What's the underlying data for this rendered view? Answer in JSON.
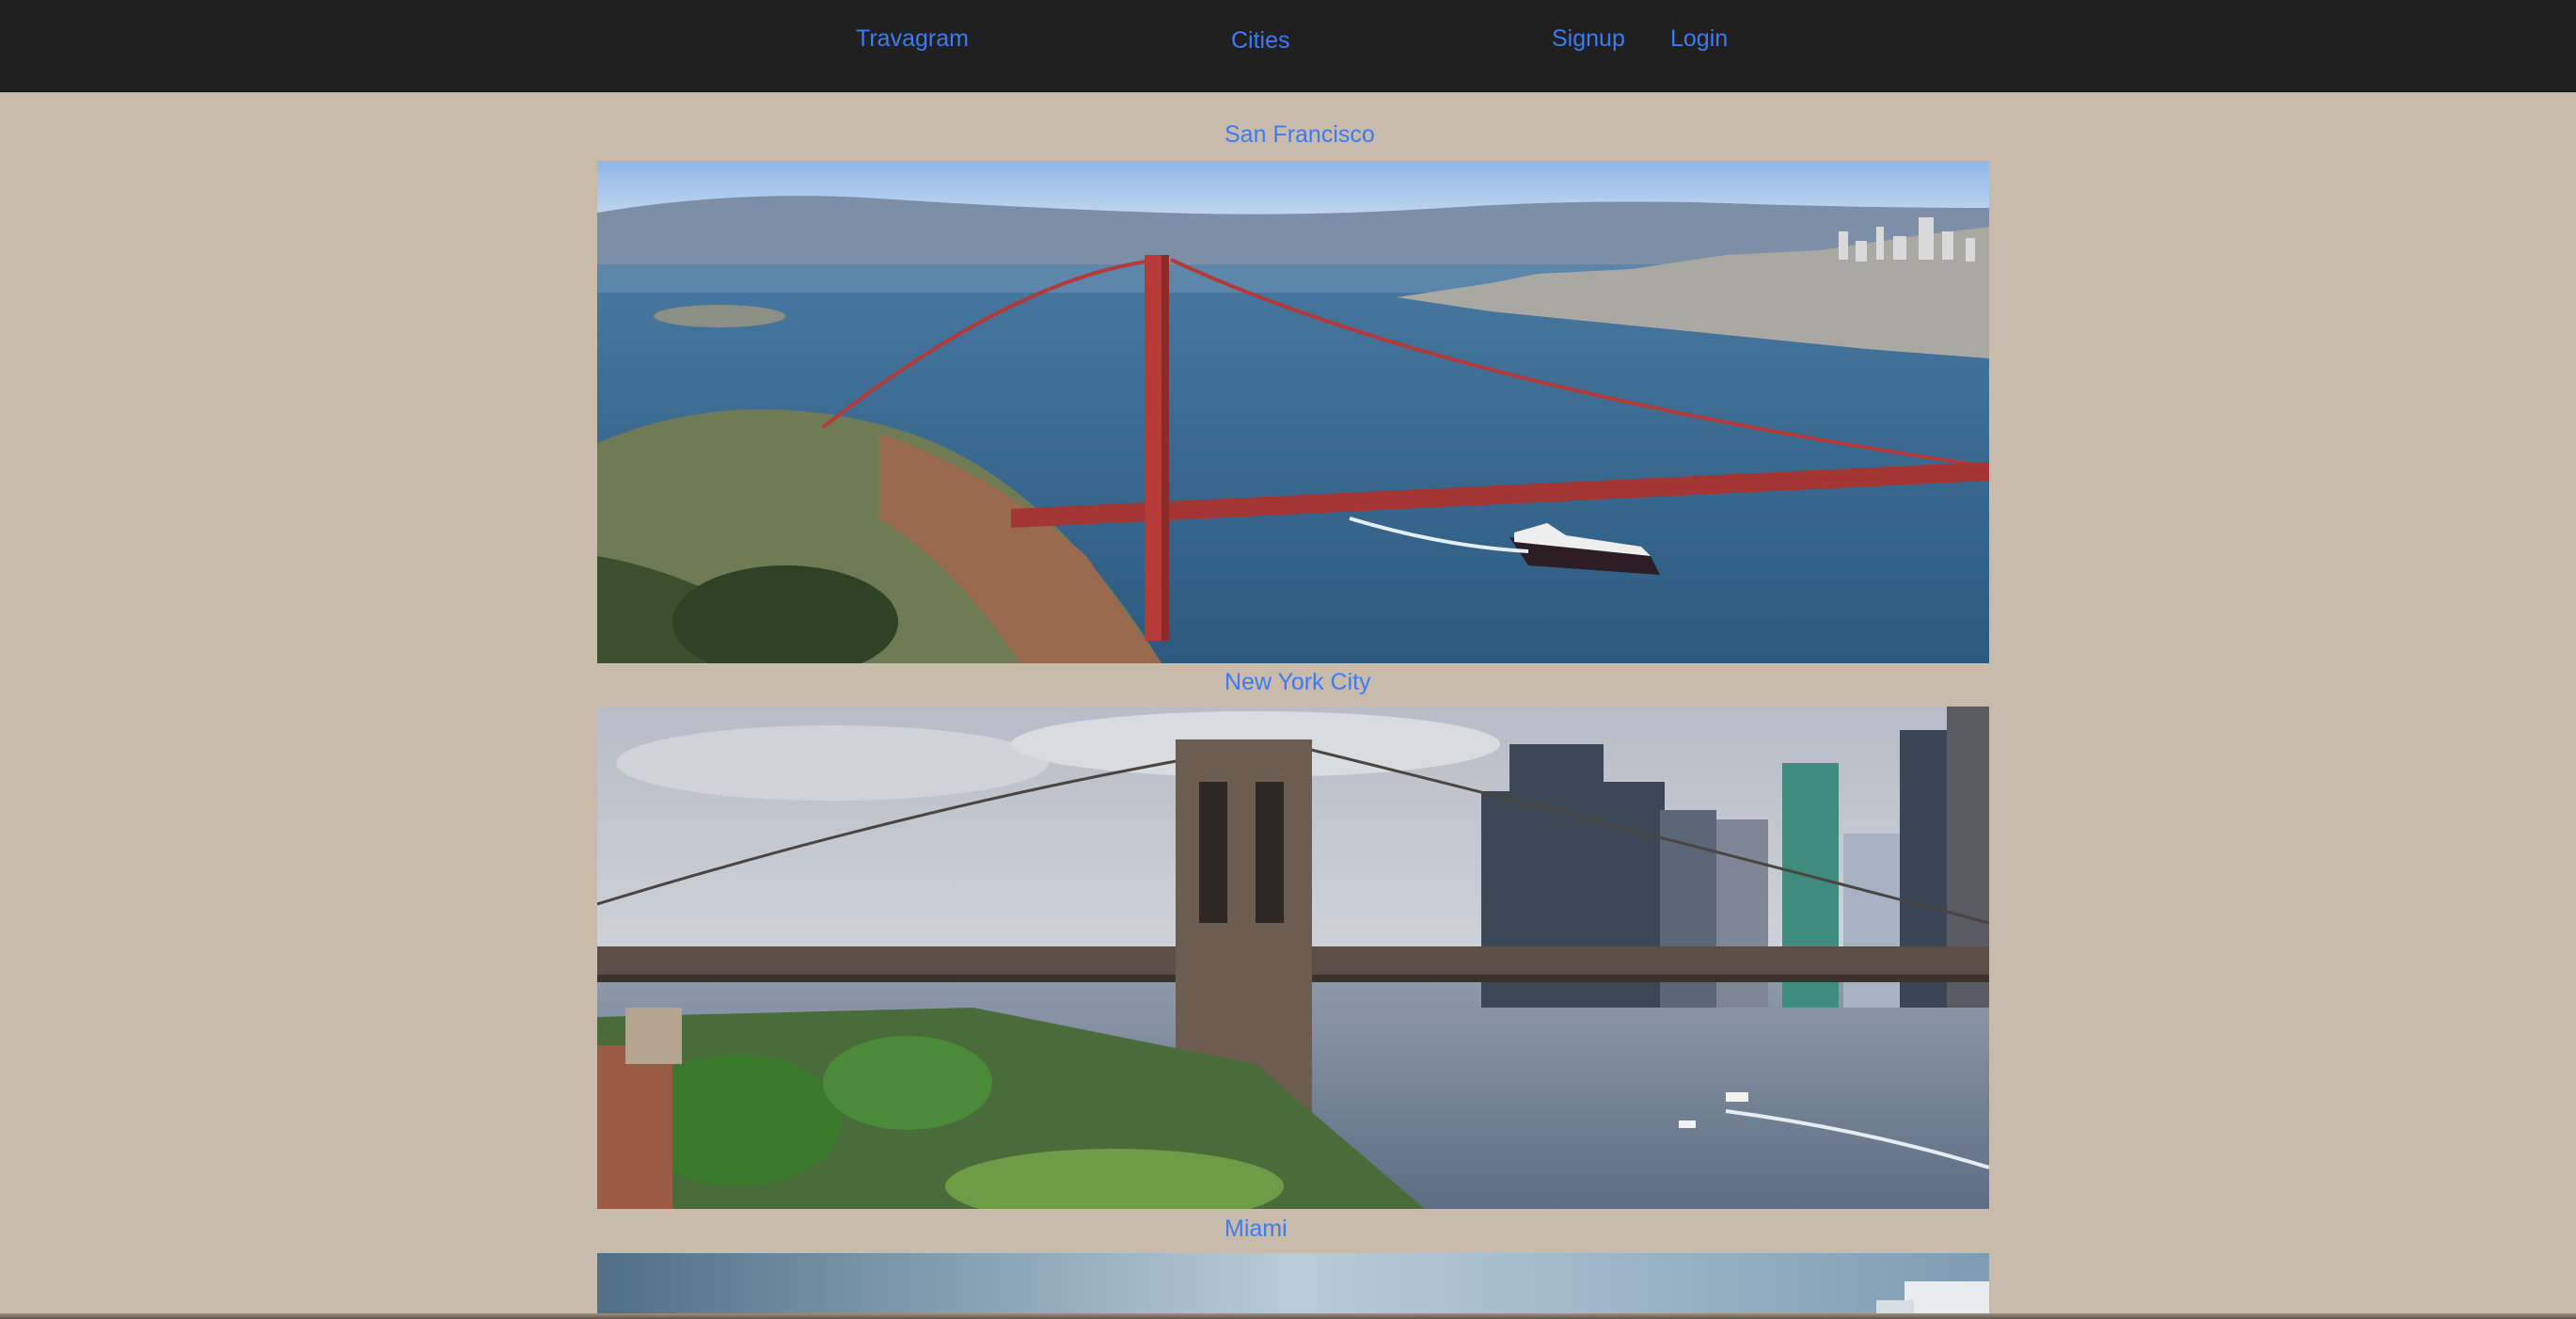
{
  "navbar": {
    "brand": "Travagram",
    "cities": "Cities",
    "signup": "Signup",
    "login": "Login"
  },
  "cities": [
    {
      "name": "San Francisco",
      "image": "golden-gate-bridge-photo"
    },
    {
      "name": "New York City",
      "image": "brooklyn-bridge-photo"
    },
    {
      "name": "Miami",
      "image": "miami-waterfront-photo"
    }
  ],
  "colors": {
    "nav_background": "#202020",
    "page_background": "#c9bbab",
    "link": "#3d7bf0"
  }
}
